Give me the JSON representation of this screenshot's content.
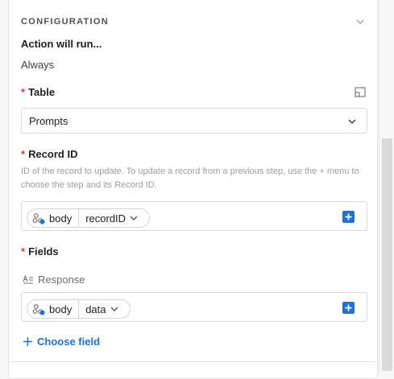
{
  "configuration": {
    "section_title": "CONFIGURATION",
    "action_label": "Action will run...",
    "action_value": "Always"
  },
  "table_field": {
    "required_mark": "*",
    "label": "Table",
    "selected": "Prompts",
    "expand_icon": "expand-icon",
    "chevron_icon": "chevron-down-icon"
  },
  "record_id_field": {
    "required_mark": "*",
    "label": "Record ID",
    "help_line1": "ID of the record to update. To update a record from a previous step, use the + menu to",
    "help_line2": "choose the step and its Record ID.",
    "token_source": "body",
    "token_key": "recordID",
    "plus_icon": "plus-icon"
  },
  "fields_field": {
    "required_mark": "*",
    "label": "Fields",
    "field_name": "Response",
    "field_icon": "long-text-icon",
    "token_source": "body",
    "token_key": "data",
    "choose_label": "Choose field"
  },
  "colors": {
    "accent": "#1a73d9",
    "required": "#d7373f",
    "helper_text": "#9a9da3"
  }
}
